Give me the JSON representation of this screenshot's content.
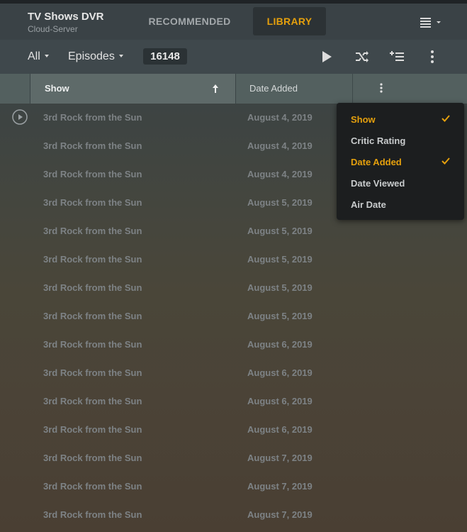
{
  "header": {
    "title": "TV Shows DVR",
    "server": "Cloud-Server",
    "tabs": [
      {
        "label": "RECOMMENDED",
        "active": false
      },
      {
        "label": "LIBRARY",
        "active": true
      }
    ],
    "view_icon": "list-view-icon"
  },
  "toolbar": {
    "filter_label": "All",
    "type_label": "Episodes",
    "count": "16148",
    "icons": [
      "play-icon",
      "shuffle-icon",
      "add-to-queue-icon",
      "more-vertical-icon"
    ]
  },
  "columns": {
    "show": "Show",
    "date_added": "Date Added",
    "sort_direction": "ascending"
  },
  "rows": [
    {
      "show": "3rd Rock from the Sun",
      "date": "August 4, 2019"
    },
    {
      "show": "3rd Rock from the Sun",
      "date": "August 4, 2019"
    },
    {
      "show": "3rd Rock from the Sun",
      "date": "August 4, 2019"
    },
    {
      "show": "3rd Rock from the Sun",
      "date": "August 5, 2019"
    },
    {
      "show": "3rd Rock from the Sun",
      "date": "August 5, 2019"
    },
    {
      "show": "3rd Rock from the Sun",
      "date": "August 5, 2019"
    },
    {
      "show": "3rd Rock from the Sun",
      "date": "August 5, 2019"
    },
    {
      "show": "3rd Rock from the Sun",
      "date": "August 5, 2019"
    },
    {
      "show": "3rd Rock from the Sun",
      "date": "August 6, 2019"
    },
    {
      "show": "3rd Rock from the Sun",
      "date": "August 6, 2019"
    },
    {
      "show": "3rd Rock from the Sun",
      "date": "August 6, 2019"
    },
    {
      "show": "3rd Rock from the Sun",
      "date": "August 6, 2019"
    },
    {
      "show": "3rd Rock from the Sun",
      "date": "August 7, 2019"
    },
    {
      "show": "3rd Rock from the Sun",
      "date": "August 7, 2019"
    },
    {
      "show": "3rd Rock from the Sun",
      "date": "August 7, 2019"
    }
  ],
  "column_menu": {
    "items": [
      {
        "label": "Show",
        "checked": true
      },
      {
        "label": "Critic Rating",
        "checked": false
      },
      {
        "label": "Date Added",
        "checked": true
      },
      {
        "label": "Date Viewed",
        "checked": false
      },
      {
        "label": "Air Date",
        "checked": false
      }
    ]
  },
  "colors": {
    "accent": "#e5a00d",
    "menu_bg": "#1c1e1f",
    "row_text": "#7d8285"
  }
}
